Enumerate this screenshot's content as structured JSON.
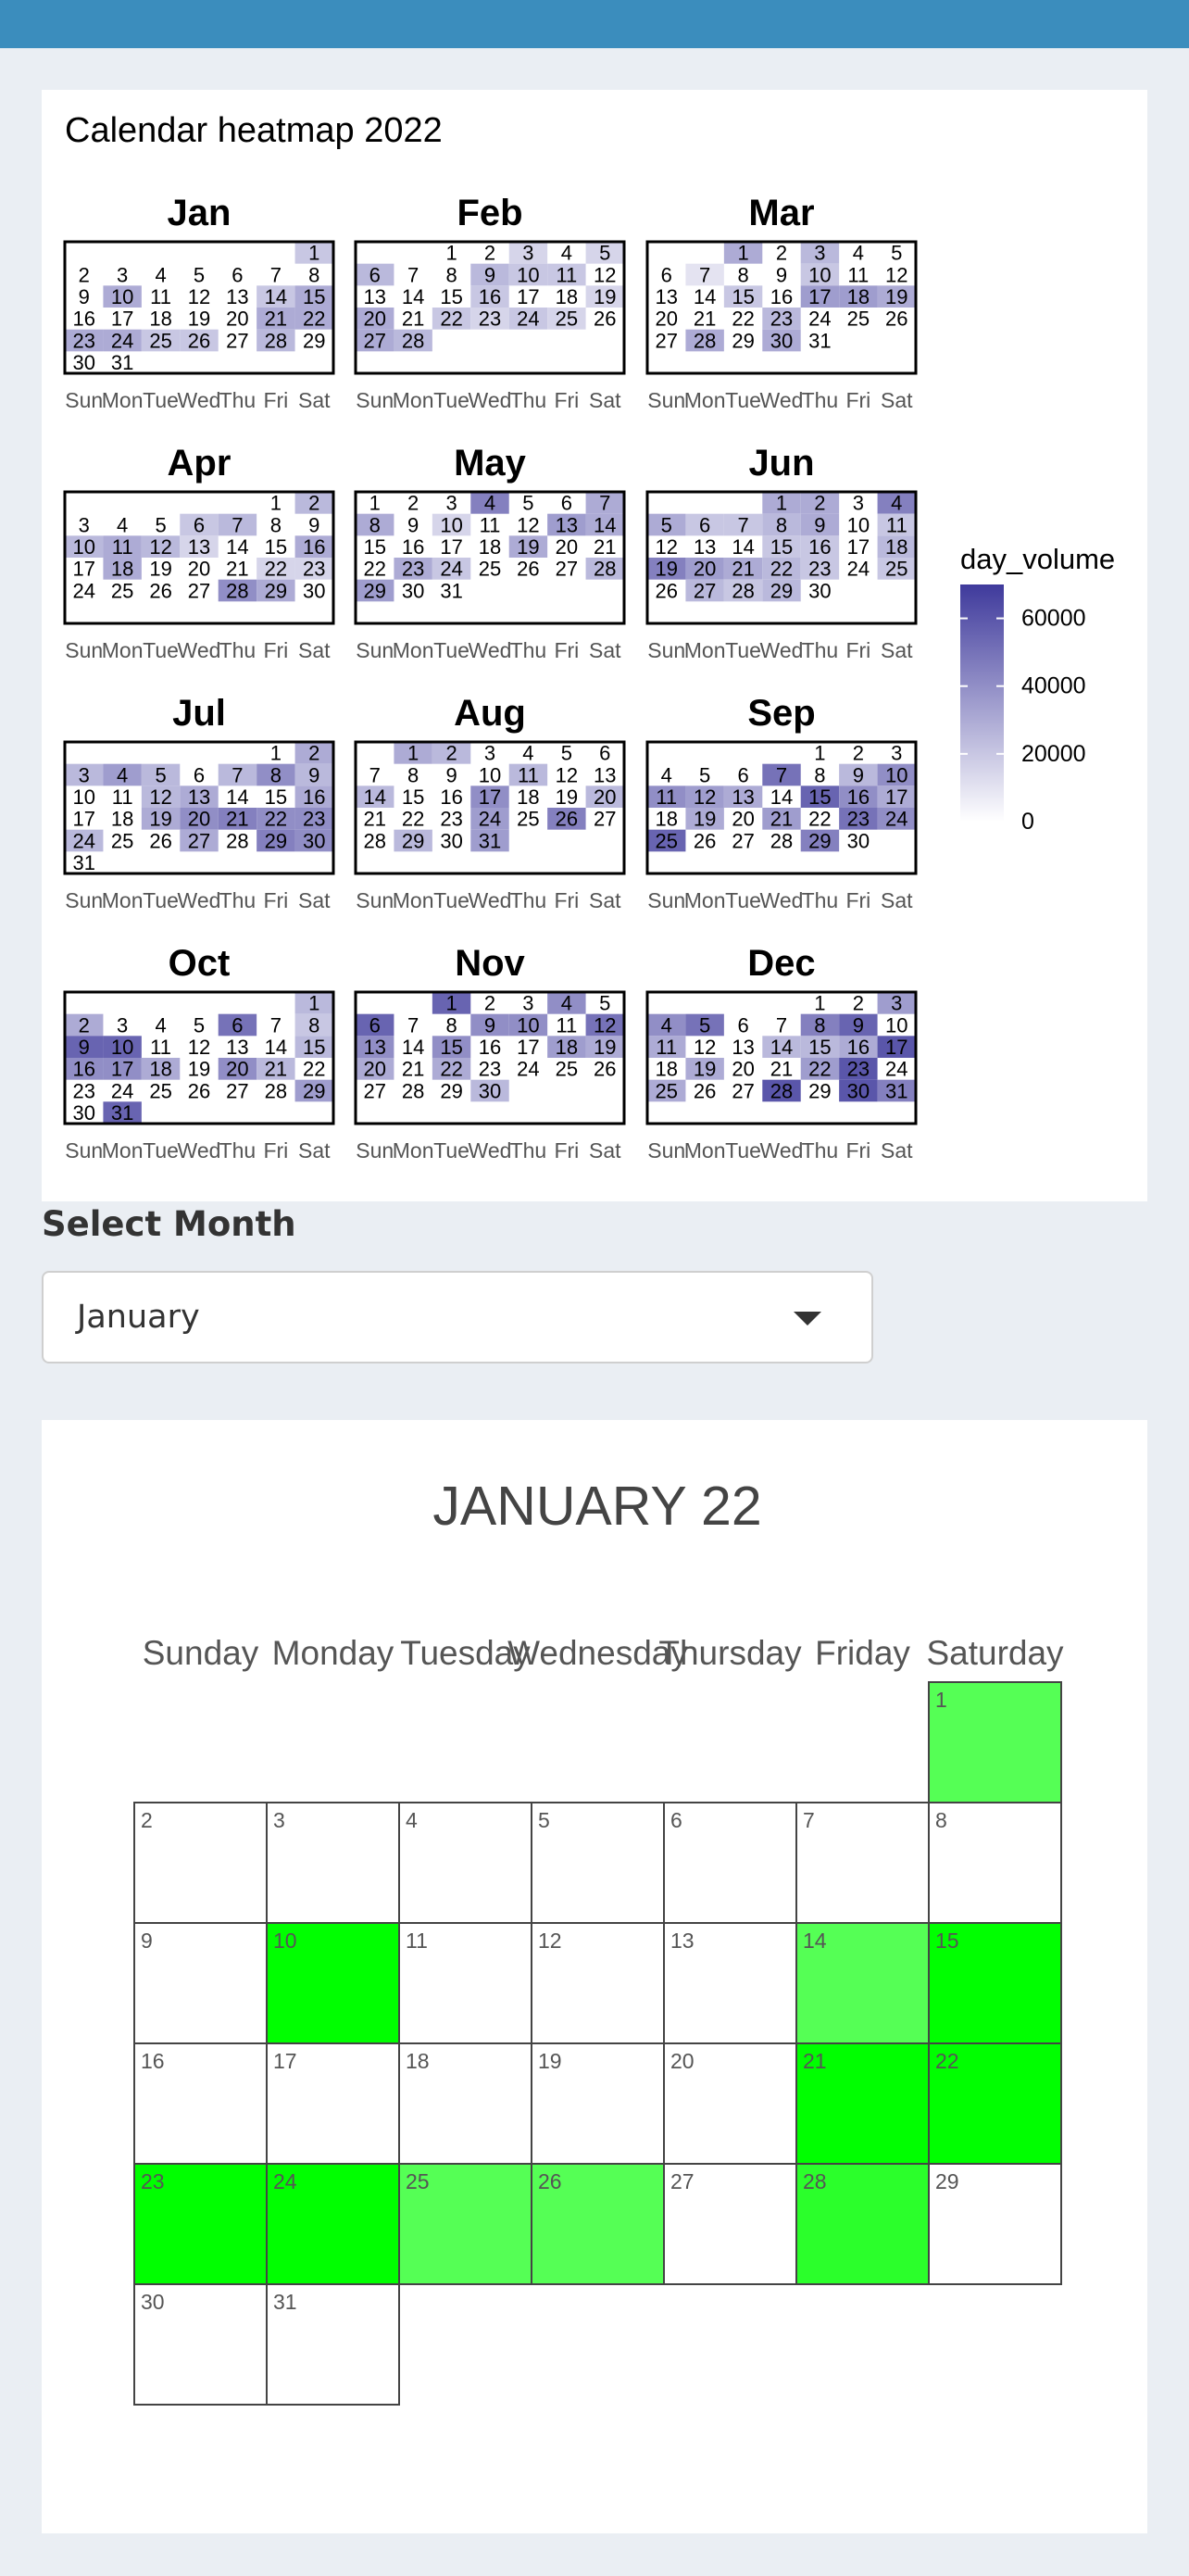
{
  "heatmap": {
    "title": "Calendar heatmap 2022",
    "weekday_labels": [
      "Sun",
      "Mon",
      "Tue",
      "Wed",
      "Thu",
      "Fri",
      "Sat"
    ],
    "legend": {
      "title": "day_volume",
      "ticks": [
        60000,
        40000,
        20000,
        0
      ],
      "max": 70000,
      "low_color": "#ffffff",
      "high_color": "#3f3a9c"
    }
  },
  "selector": {
    "label": "Select Month",
    "value": "January",
    "options_visible": [
      "January"
    ]
  },
  "month_view": {
    "title": "JANUARY 22",
    "weekdays": [
      "Sunday",
      "Monday",
      "Tuesday",
      "Wednesday",
      "Thursday",
      "Friday",
      "Saturday"
    ],
    "high_color": "#00ff00"
  },
  "chart_data": {
    "type": "heatmap",
    "title": "Calendar heatmap 2022",
    "year": 2022,
    "value_name": "day_volume",
    "scale": {
      "min": 0,
      "max": 70000
    },
    "months": [
      {
        "name": "Jan",
        "days": [
          [
            1,
            20000
          ],
          [
            10,
            30000
          ],
          [
            14,
            20000
          ],
          [
            15,
            30000
          ],
          [
            21,
            30000
          ],
          [
            22,
            30000
          ],
          [
            23,
            30000
          ],
          [
            24,
            30000
          ],
          [
            25,
            20000
          ],
          [
            26,
            20000
          ],
          [
            28,
            25000
          ]
        ]
      },
      {
        "name": "Feb",
        "days": [
          [
            3,
            15000
          ],
          [
            5,
            15000
          ],
          [
            6,
            25000
          ],
          [
            9,
            25000
          ],
          [
            10,
            20000
          ],
          [
            11,
            20000
          ],
          [
            16,
            20000
          ],
          [
            19,
            15000
          ],
          [
            20,
            30000
          ],
          [
            22,
            20000
          ],
          [
            23,
            15000
          ],
          [
            24,
            20000
          ],
          [
            25,
            15000
          ],
          [
            27,
            30000
          ],
          [
            28,
            25000
          ]
        ]
      },
      {
        "name": "Mar",
        "days": [
          [
            1,
            30000
          ],
          [
            3,
            25000
          ],
          [
            7,
            10000
          ],
          [
            10,
            20000
          ],
          [
            15,
            20000
          ],
          [
            17,
            35000
          ],
          [
            18,
            35000
          ],
          [
            19,
            30000
          ],
          [
            23,
            25000
          ],
          [
            28,
            30000
          ],
          [
            30,
            30000
          ]
        ]
      },
      {
        "name": "Apr",
        "days": [
          [
            2,
            25000
          ],
          [
            6,
            20000
          ],
          [
            7,
            25000
          ],
          [
            10,
            25000
          ],
          [
            11,
            30000
          ],
          [
            12,
            25000
          ],
          [
            13,
            15000
          ],
          [
            16,
            30000
          ],
          [
            18,
            30000
          ],
          [
            22,
            15000
          ],
          [
            23,
            15000
          ],
          [
            28,
            40000
          ],
          [
            29,
            30000
          ]
        ]
      },
      {
        "name": "May",
        "days": [
          [
            4,
            45000
          ],
          [
            7,
            30000
          ],
          [
            8,
            30000
          ],
          [
            10,
            15000
          ],
          [
            13,
            35000
          ],
          [
            14,
            30000
          ],
          [
            19,
            30000
          ],
          [
            23,
            30000
          ],
          [
            24,
            20000
          ],
          [
            28,
            25000
          ],
          [
            29,
            35000
          ]
        ]
      },
      {
        "name": "Jun",
        "days": [
          [
            1,
            30000
          ],
          [
            2,
            30000
          ],
          [
            4,
            45000
          ],
          [
            5,
            30000
          ],
          [
            6,
            20000
          ],
          [
            7,
            20000
          ],
          [
            8,
            25000
          ],
          [
            9,
            30000
          ],
          [
            11,
            20000
          ],
          [
            15,
            20000
          ],
          [
            16,
            20000
          ],
          [
            18,
            25000
          ],
          [
            19,
            45000
          ],
          [
            20,
            35000
          ],
          [
            21,
            30000
          ],
          [
            22,
            25000
          ],
          [
            23,
            20000
          ],
          [
            25,
            20000
          ],
          [
            27,
            25000
          ],
          [
            28,
            20000
          ],
          [
            29,
            25000
          ]
        ]
      },
      {
        "name": "Jul",
        "days": [
          [
            2,
            30000
          ],
          [
            3,
            25000
          ],
          [
            4,
            35000
          ],
          [
            5,
            25000
          ],
          [
            7,
            25000
          ],
          [
            8,
            40000
          ],
          [
            9,
            25000
          ],
          [
            12,
            25000
          ],
          [
            13,
            30000
          ],
          [
            16,
            30000
          ],
          [
            19,
            30000
          ],
          [
            20,
            40000
          ],
          [
            21,
            45000
          ],
          [
            22,
            40000
          ],
          [
            23,
            40000
          ],
          [
            24,
            25000
          ],
          [
            27,
            30000
          ],
          [
            29,
            45000
          ],
          [
            30,
            40000
          ]
        ]
      },
      {
        "name": "Aug",
        "days": [
          [
            1,
            30000
          ],
          [
            2,
            25000
          ],
          [
            11,
            25000
          ],
          [
            14,
            25000
          ],
          [
            17,
            40000
          ],
          [
            20,
            25000
          ],
          [
            24,
            35000
          ],
          [
            26,
            45000
          ],
          [
            29,
            25000
          ],
          [
            31,
            35000
          ]
        ]
      },
      {
        "name": "Sep",
        "days": [
          [
            7,
            50000
          ],
          [
            9,
            25000
          ],
          [
            10,
            40000
          ],
          [
            11,
            40000
          ],
          [
            12,
            35000
          ],
          [
            13,
            30000
          ],
          [
            15,
            55000
          ],
          [
            16,
            40000
          ],
          [
            17,
            30000
          ],
          [
            19,
            30000
          ],
          [
            21,
            35000
          ],
          [
            23,
            50000
          ],
          [
            24,
            40000
          ],
          [
            25,
            55000
          ],
          [
            29,
            45000
          ]
        ]
      },
      {
        "name": "Oct",
        "days": [
          [
            1,
            25000
          ],
          [
            2,
            30000
          ],
          [
            6,
            50000
          ],
          [
            8,
            20000
          ],
          [
            9,
            55000
          ],
          [
            10,
            55000
          ],
          [
            15,
            25000
          ],
          [
            16,
            40000
          ],
          [
            17,
            40000
          ],
          [
            18,
            30000
          ],
          [
            20,
            40000
          ],
          [
            21,
            25000
          ],
          [
            29,
            35000
          ],
          [
            31,
            55000
          ]
        ]
      },
      {
        "name": "Nov",
        "days": [
          [
            1,
            55000
          ],
          [
            4,
            40000
          ],
          [
            6,
            55000
          ],
          [
            9,
            40000
          ],
          [
            10,
            40000
          ],
          [
            12,
            50000
          ],
          [
            13,
            40000
          ],
          [
            15,
            40000
          ],
          [
            18,
            35000
          ],
          [
            19,
            30000
          ],
          [
            20,
            30000
          ],
          [
            22,
            30000
          ],
          [
            30,
            25000
          ]
        ]
      },
      {
        "name": "Dec",
        "days": [
          [
            3,
            35000
          ],
          [
            4,
            40000
          ],
          [
            5,
            50000
          ],
          [
            8,
            45000
          ],
          [
            9,
            55000
          ],
          [
            11,
            30000
          ],
          [
            14,
            25000
          ],
          [
            15,
            25000
          ],
          [
            16,
            30000
          ],
          [
            17,
            60000
          ],
          [
            19,
            30000
          ],
          [
            22,
            35000
          ],
          [
            23,
            60000
          ],
          [
            25,
            30000
          ],
          [
            28,
            60000
          ],
          [
            30,
            60000
          ],
          [
            31,
            45000
          ]
        ]
      }
    ]
  }
}
